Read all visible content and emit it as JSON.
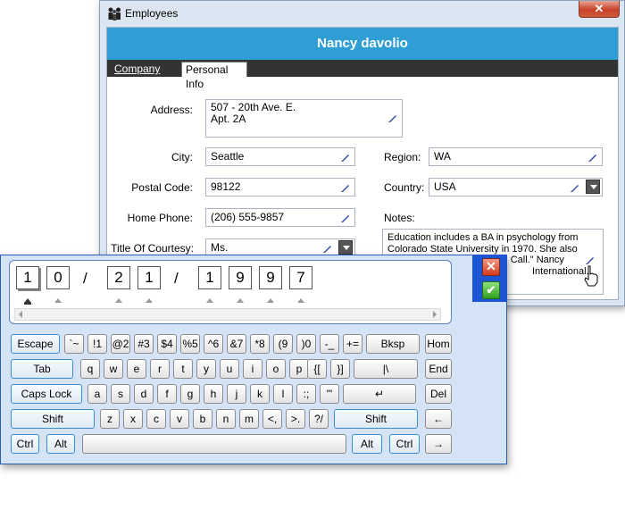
{
  "window": {
    "title": "Employees",
    "close_glyph": "✕",
    "header_name": "Nancy davolio",
    "tabs": [
      {
        "label": "Company Info",
        "selected": false
      },
      {
        "label": "Personal Info",
        "selected": true
      }
    ]
  },
  "form": {
    "address_label": "Address:",
    "address_line1": "507 - 20th Ave. E.",
    "address_line2": "Apt. 2A",
    "city_label": "City:",
    "city_value": "Seattle",
    "region_label": "Region:",
    "region_value": "WA",
    "postal_label": "Postal Code:",
    "postal_value": "98122",
    "country_label": "Country:",
    "country_value": "USA",
    "phone_label": "Home Phone:",
    "phone_value": "(206) 555-9857",
    "notes_label": "Notes:",
    "notes_lines": [
      "Education includes a BA in psychology from",
      "Colorado State University in 1970.  She also",
      "old Call.\"  Nancy",
      "International."
    ],
    "courtesy_label": "Title Of Courtesy:",
    "courtesy_value": "Ms."
  },
  "keyboard": {
    "date_digits": [
      "1",
      "0",
      "2",
      "1",
      "1",
      "9",
      "9",
      "7"
    ],
    "separator": "/",
    "row1": [
      "Escape",
      "`~",
      "!1",
      "@2",
      "#3",
      "$4",
      "%5",
      "^6",
      "&7",
      "*8",
      "(9",
      ")0",
      "-_",
      "+=",
      "Bksp",
      "Hom"
    ],
    "row2": [
      "Tab",
      "q",
      "w",
      "e",
      "r",
      "t",
      "y",
      "u",
      "i",
      "o",
      "p",
      "{[",
      "}]",
      "|\\",
      "End"
    ],
    "row3": [
      "Caps Lock",
      "a",
      "s",
      "d",
      "f",
      "g",
      "h",
      "j",
      "k",
      "l",
      ":;",
      "\"'",
      "↵",
      "Del"
    ],
    "row4": [
      "Shift",
      "z",
      "x",
      "c",
      "v",
      "b",
      "n",
      "m",
      "<,",
      ">.",
      "?/",
      "Shift",
      "←"
    ],
    "row5": [
      "Ctrl",
      "Alt",
      "",
      "Alt",
      "Ctrl",
      "→"
    ],
    "close_glyph": "✕",
    "ok_glyph": "✔"
  },
  "colors": {
    "header_blue": "#2f9ed5",
    "tab_bar": "#333333",
    "keyboard_bg": "#d5e3f7",
    "accent_blue": "#1c56d4"
  }
}
